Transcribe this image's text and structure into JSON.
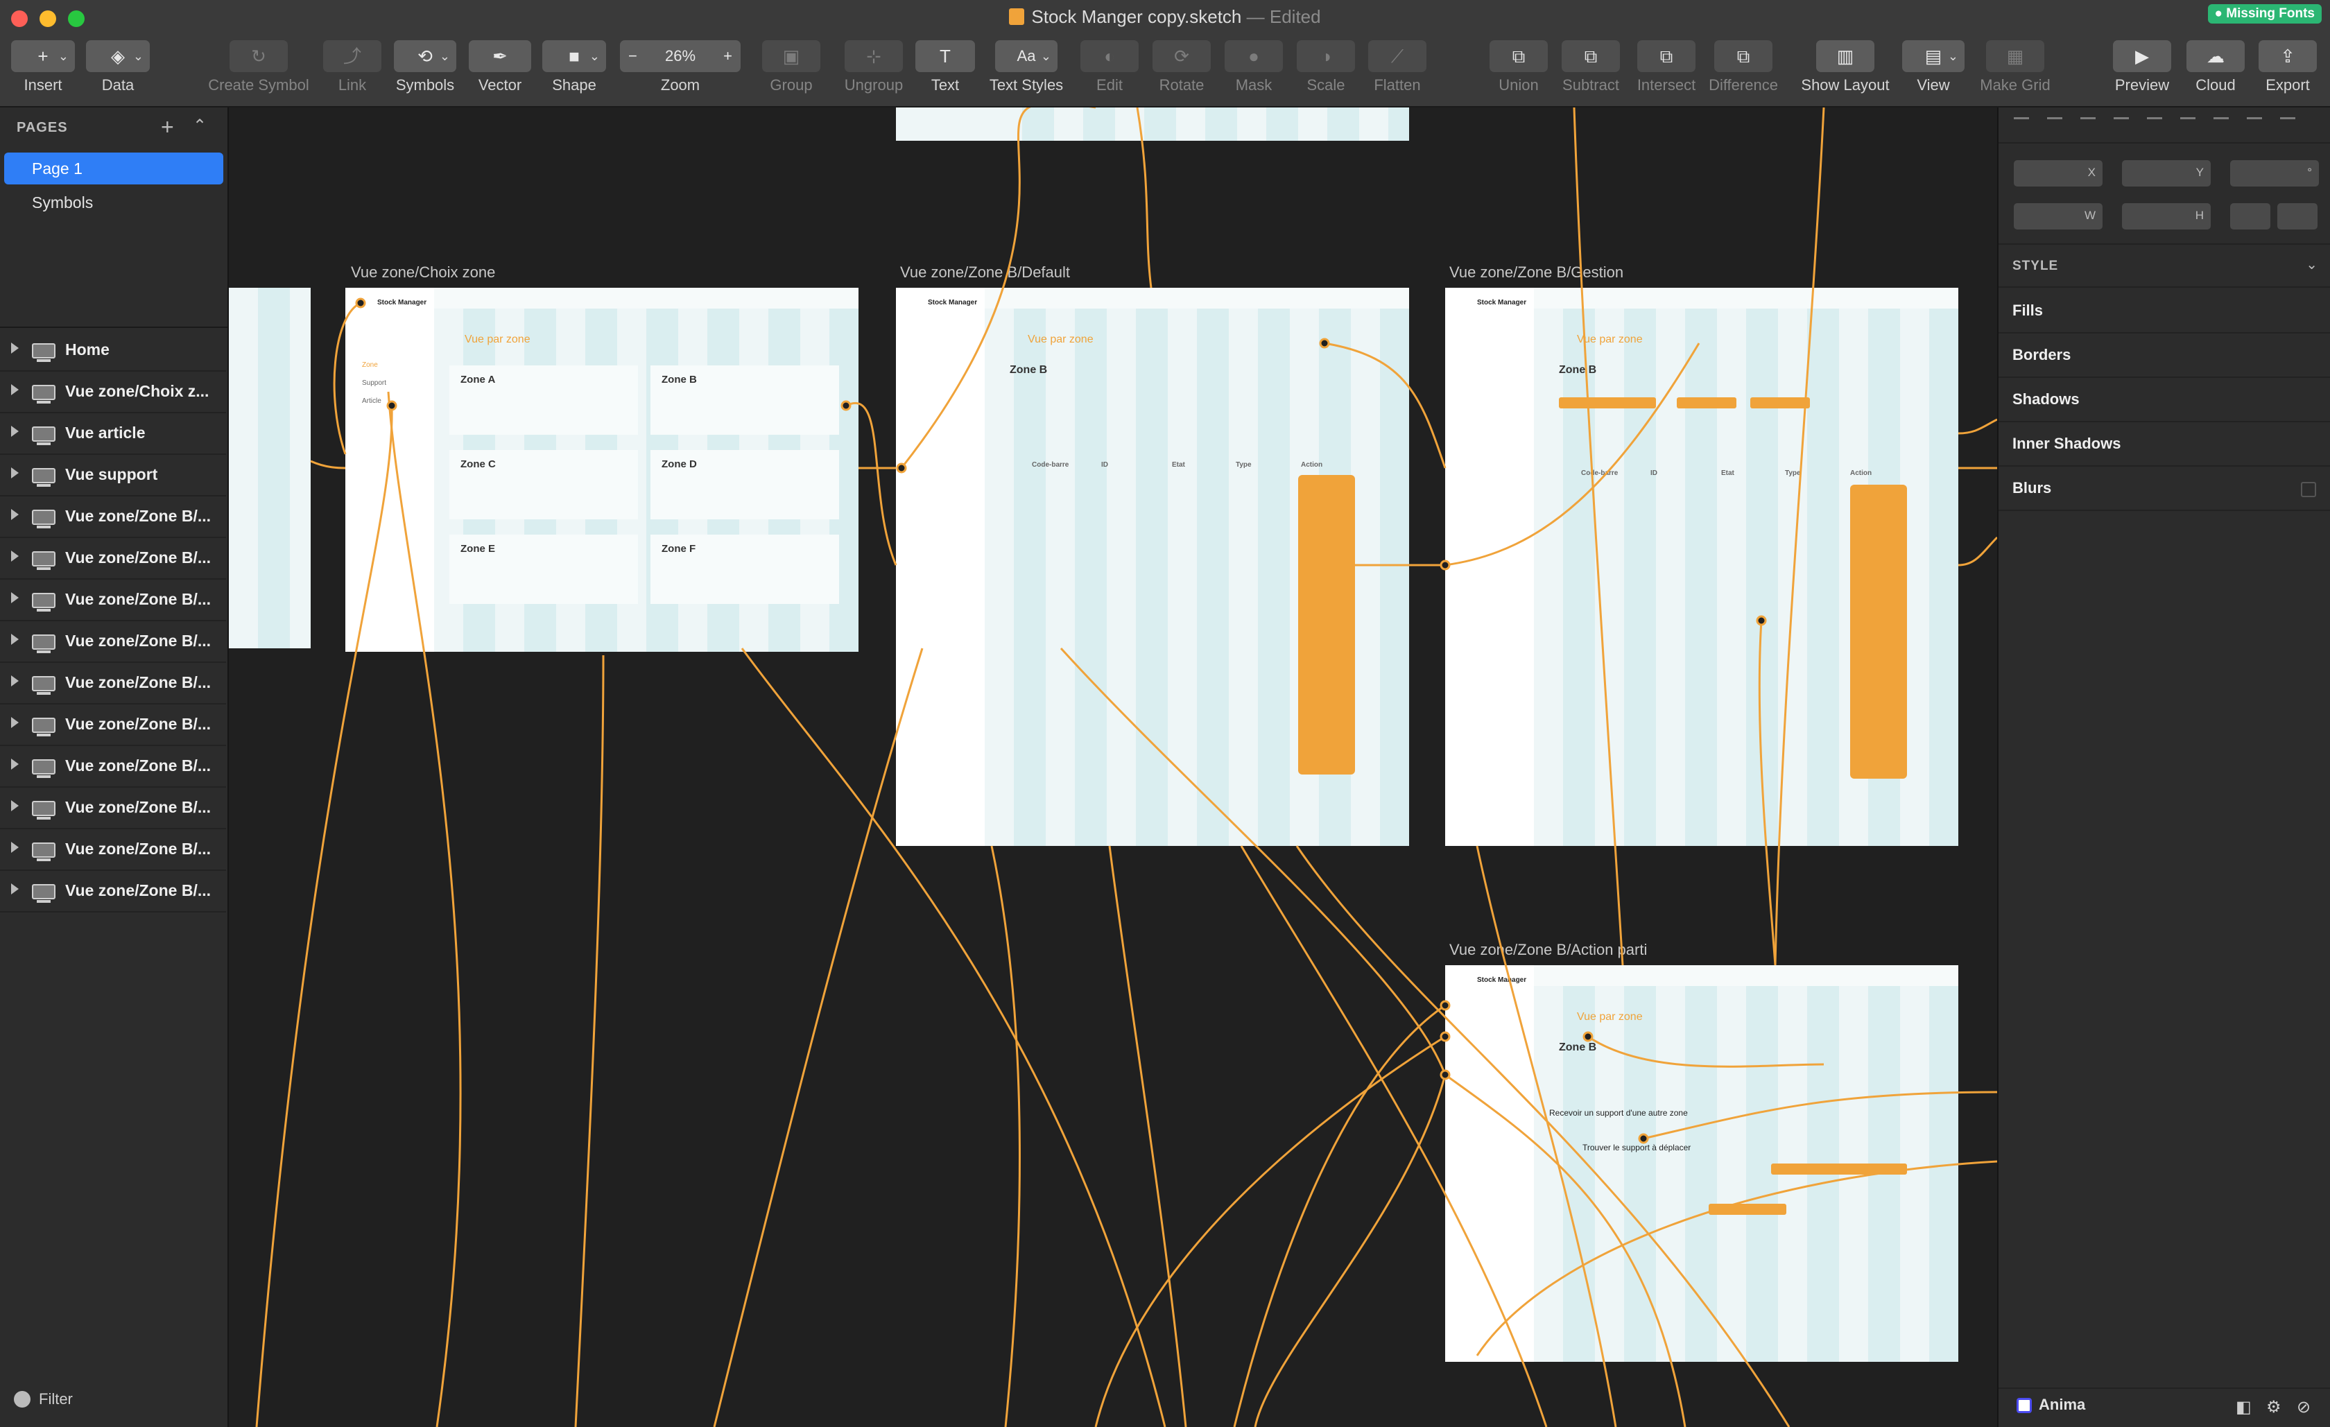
{
  "window": {
    "title": "Stock Manger copy.sketch",
    "status": "— Edited",
    "missing_fonts_badge": "● Missing Fonts"
  },
  "toolbar": {
    "insert": "Insert",
    "data": "Data",
    "create_symbol": "Create Symbol",
    "link": "Link",
    "symbols": "Symbols",
    "vector": "Vector",
    "shape": "Shape",
    "zoom_label": "Zoom",
    "zoom_value": "26%",
    "zoom_minus": "−",
    "zoom_plus": "+",
    "group": "Group",
    "ungroup": "Ungroup",
    "text": "Text",
    "text_styles": "Text Styles",
    "text_styles_btn": "Aa",
    "edit": "Edit",
    "rotate": "Rotate",
    "mask": "Mask",
    "scale": "Scale",
    "flatten": "Flatten",
    "union": "Union",
    "subtract": "Subtract",
    "intersect": "Intersect",
    "difference": "Difference",
    "show_layout": "Show Layout",
    "view": "View",
    "make_grid": "Make Grid",
    "preview": "Preview",
    "cloud": "Cloud",
    "export": "Export"
  },
  "pages_panel": {
    "header": "PAGES",
    "pages": [
      "Page 1",
      "Symbols"
    ],
    "selected": "Page 1"
  },
  "layers": [
    "Home",
    "Vue zone/Choix z...",
    "Vue article",
    "Vue support",
    "Vue zone/Zone B/...",
    "Vue zone/Zone B/...",
    "Vue zone/Zone B/...",
    "Vue zone/Zone B/...",
    "Vue zone/Zone B/...",
    "Vue zone/Zone B/...",
    "Vue zone/Zone B/...",
    "Vue zone/Zone B/...",
    "Vue zone/Zone B/...",
    "Vue zone/Zone B/..."
  ],
  "filter_label": "Filter",
  "artboards": {
    "choix": {
      "title": "Vue zone/Choix zone",
      "app_name": "Stock Manager",
      "heading": "Vue par zone",
      "zones": [
        "Zone A",
        "Zone B",
        "Zone C",
        "Zone D",
        "Zone E",
        "Zone F"
      ],
      "nav": [
        "Zone",
        "Support",
        "Article"
      ]
    },
    "default": {
      "title": "Vue zone/Zone B/Default",
      "app_name": "Stock Manager",
      "heading": "Vue par zone",
      "zone_name": "Zone B",
      "columns": [
        "Code-barre",
        "ID",
        "Etat",
        "Type",
        "Action"
      ]
    },
    "gestion": {
      "title": "Vue zone/Zone B/Gestion",
      "app_name": "Stock Manager",
      "heading": "Vue par zone",
      "zone_name": "Zone B",
      "columns": [
        "Code-barre",
        "ID",
        "Etat",
        "Type",
        "Action"
      ]
    },
    "action": {
      "title": "Vue zone/Zone B/Action parti",
      "app_name": "Stock Manager",
      "heading": "Vue par zone",
      "zone_name": "Zone B",
      "section": "Recevoir un support d'une autre zone",
      "subsection": "Trouver le support à déplacer"
    }
  },
  "inspector": {
    "x": "X",
    "y": "Y",
    "w": "W",
    "h": "H",
    "rotation": "°",
    "style_header": "STYLE",
    "sections": [
      "Fills",
      "Borders",
      "Shadows",
      "Inner Shadows",
      "Blurs"
    ],
    "plugin": "Anima"
  },
  "colors": {
    "accent": "#f0a33a",
    "selection": "#2f7ef6",
    "badge": "#2bb673"
  }
}
